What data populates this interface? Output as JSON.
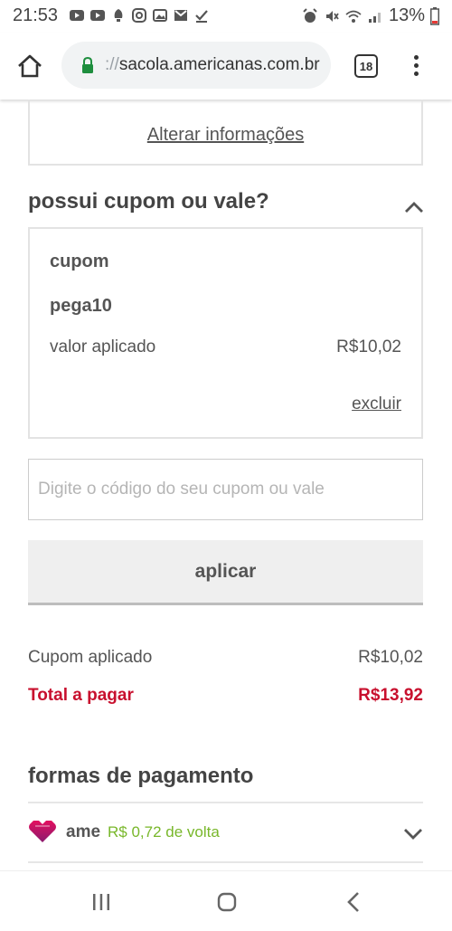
{
  "status_bar": {
    "time": "21:53",
    "battery": "13%",
    "left_icons": [
      "youtube-icon",
      "youtube-icon",
      "notification-icon",
      "instagram-icon",
      "photos-icon",
      "gmail-icon",
      "download-done-icon"
    ],
    "right_icons": [
      "alarm-icon",
      "mute-icon",
      "wifi-icon",
      "signal-icon",
      "battery-icon"
    ]
  },
  "browser": {
    "url_scheme": "://",
    "url_host": "sacola.americanas.com.br",
    "tab_count": "18"
  },
  "delivery": {
    "edit_link": "Alterar informações"
  },
  "coupon_section": {
    "title": "possui cupom ou vale?",
    "applied": {
      "label": "cupom",
      "code": "pega10",
      "value_label": "valor aplicado",
      "value": "R$10,02",
      "remove_link": "excluir"
    },
    "input_placeholder": "Digite o código do seu cupom ou vale",
    "apply_button": "aplicar"
  },
  "summary": {
    "coupon_label": "Cupom aplicado",
    "coupon_value": "R$10,02",
    "total_label": "Total a pagar",
    "total_value": "R$13,92"
  },
  "payment": {
    "title": "formas de pagamento",
    "methods": [
      {
        "name": "ame",
        "cashback": "R$ 0,72 de volta"
      }
    ]
  },
  "colors": {
    "total_red": "#c8102e",
    "cashback_green": "#78b72a",
    "lock_green": "#1e8e3e"
  }
}
